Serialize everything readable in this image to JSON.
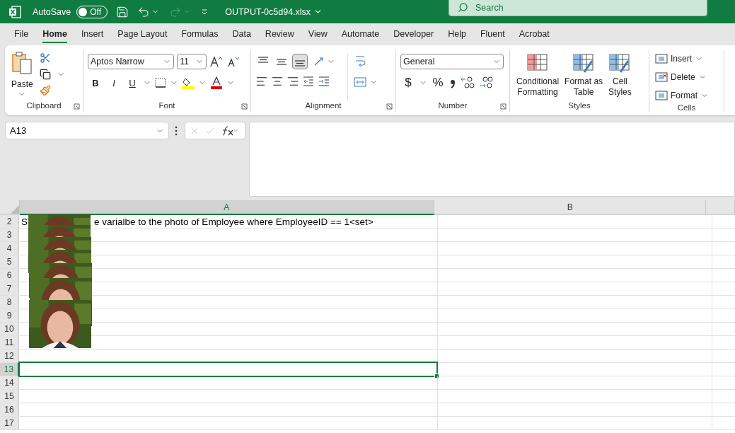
{
  "title_bar": {
    "autosave_label": "AutoSave",
    "autosave_toggle": {
      "on": false,
      "label": "Off"
    },
    "file_name": "OUTPUT-0c5d94.xlsx",
    "search": {
      "placeholder": "Search"
    }
  },
  "menu_tabs": [
    {
      "label": "File",
      "selected": false
    },
    {
      "label": "Home",
      "selected": true
    },
    {
      "label": "Insert",
      "selected": false
    },
    {
      "label": "Page Layout",
      "selected": false
    },
    {
      "label": "Formulas",
      "selected": false
    },
    {
      "label": "Data",
      "selected": false
    },
    {
      "label": "Review",
      "selected": false
    },
    {
      "label": "View",
      "selected": false
    },
    {
      "label": "Automate",
      "selected": false
    },
    {
      "label": "Developer",
      "selected": false
    },
    {
      "label": "Help",
      "selected": false
    },
    {
      "label": "Fluent",
      "selected": false
    },
    {
      "label": "Acrobat",
      "selected": false
    }
  ],
  "ribbon": {
    "clipboard": {
      "paste_label": "Paste",
      "group": "Clipboard"
    },
    "font": {
      "name": "Aptos Narrow",
      "size": "11",
      "bold": "B",
      "italic": "I",
      "underline": "U",
      "group": "Font"
    },
    "alignment": {
      "vertical": [
        {
          "selected": false
        },
        {
          "selected": false
        },
        {
          "selected": true
        }
      ],
      "group": "Alignment"
    },
    "number": {
      "format": "General",
      "currency": "$",
      "percent": "%",
      "group": "Number"
    },
    "styles": {
      "buttons": [
        {
          "line1": "Conditional",
          "line2": "Formatting"
        },
        {
          "line1": "Format as",
          "line2": "Table"
        },
        {
          "line1": "Cell",
          "line2": "Styles"
        }
      ],
      "group": "Styles"
    },
    "cells": {
      "buttons": [
        "Insert",
        "Delete",
        "Format"
      ],
      "group": "Cells"
    }
  },
  "formula_bar": {
    "name_box": "A13"
  },
  "sheet": {
    "columns": [
      "A",
      "B"
    ],
    "rows": [
      {
        "number": "2",
        "selected": false,
        "text_start": "S",
        "text_end": "e varialbe to the photo of Employee where EmployeeID == 1<set>"
      },
      {
        "number": "3",
        "selected": false
      },
      {
        "number": "4",
        "selected": false
      },
      {
        "number": "5",
        "selected": false
      },
      {
        "number": "6",
        "selected": false
      },
      {
        "number": "7",
        "selected": false
      },
      {
        "number": "8",
        "selected": false
      },
      {
        "number": "9",
        "selected": false
      },
      {
        "number": "10",
        "selected": false
      },
      {
        "number": "11",
        "selected": false
      },
      {
        "number": "12",
        "selected": false
      },
      {
        "number": "13",
        "selected": true
      },
      {
        "number": "14",
        "selected": false
      },
      {
        "number": "15",
        "selected": false
      },
      {
        "number": "16",
        "selected": false
      },
      {
        "number": "17",
        "selected": false
      }
    ],
    "pictures": [
      {
        "kind": "picture"
      },
      {
        "kind": "picture"
      },
      {
        "kind": "picture"
      },
      {
        "kind": "picture"
      },
      {
        "kind": "picture"
      },
      {
        "kind": "picture"
      },
      {
        "kind": "picture"
      }
    ]
  }
}
